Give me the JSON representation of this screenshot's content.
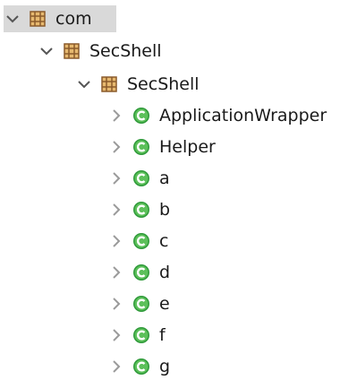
{
  "tree": {
    "root": {
      "label": "com",
      "icon": "package-icon",
      "expanded": true,
      "selected": true
    },
    "package_level1": {
      "label": "SecShell",
      "icon": "package-icon",
      "expanded": true
    },
    "package_level2": {
      "label": "SecShell",
      "icon": "package-icon",
      "expanded": true
    },
    "classes": [
      {
        "label": "ApplicationWrapper",
        "icon": "class-icon"
      },
      {
        "label": "Helper",
        "icon": "class-icon"
      },
      {
        "label": "a",
        "icon": "class-icon"
      },
      {
        "label": "b",
        "icon": "class-icon"
      },
      {
        "label": "c",
        "icon": "class-icon"
      },
      {
        "label": "d",
        "icon": "class-icon"
      },
      {
        "label": "e",
        "icon": "class-icon"
      },
      {
        "label": "f",
        "icon": "class-icon"
      },
      {
        "label": "g",
        "icon": "class-icon"
      }
    ]
  },
  "colors": {
    "package_brown": "#8a5a2b",
    "package_fill": "#e6b86f",
    "class_green": "#2f9a3a",
    "class_green_light": "#5cc05a",
    "selection": "#d9d9d9",
    "chevron": "#9a9a9a",
    "chevron_expanded": "#555555"
  }
}
